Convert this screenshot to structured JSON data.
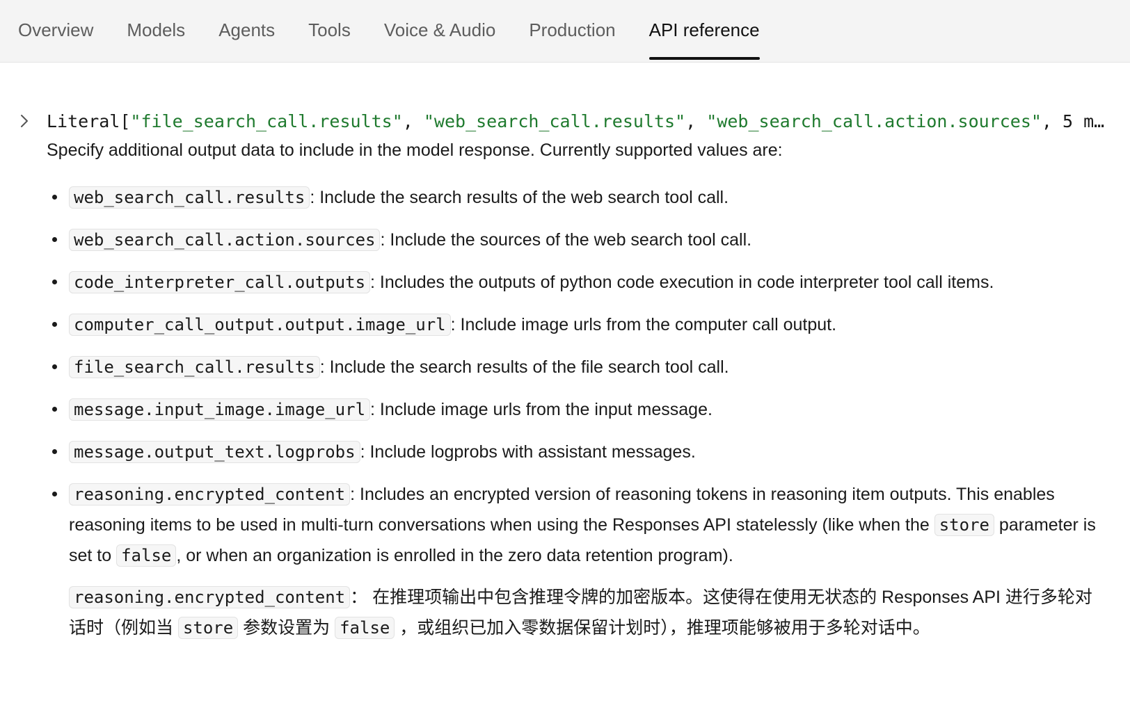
{
  "nav": {
    "tabs": [
      {
        "label": "Overview"
      },
      {
        "label": "Models"
      },
      {
        "label": "Agents"
      },
      {
        "label": "Tools"
      },
      {
        "label": "Voice & Audio"
      },
      {
        "label": "Production"
      },
      {
        "label": "API reference"
      }
    ],
    "active_tab": "API reference"
  },
  "param": {
    "type_prefix": "Literal[",
    "type_values": [
      "\"file_search_call.results\"",
      "\"web_search_call.results\"",
      "\"web_search_call.action.sources\""
    ],
    "separator": ", ",
    "type_more": "5 m…",
    "description": "Specify additional output data to include in the model response. Currently supported values are:",
    "options": [
      {
        "code": "web_search_call.results",
        "text": ": Include the search results of the web search tool call."
      },
      {
        "code": "web_search_call.action.sources",
        "text": ": Include the sources of the web search tool call."
      },
      {
        "code": "code_interpreter_call.outputs",
        "text": ": Includes the outputs of python code execution in code interpreter tool call items."
      },
      {
        "code": "computer_call_output.output.image_url",
        "text": ": Include image urls from the computer call output."
      },
      {
        "code": "file_search_call.results",
        "text": ": Include the search results of the file search tool call."
      },
      {
        "code": "message.input_image.image_url",
        "text": ": Include image urls from the input message."
      },
      {
        "code": "message.output_text.logprobs",
        "text": ": Include logprobs with assistant messages."
      }
    ],
    "reasoning": {
      "code": "reasoning.encrypted_content",
      "text_1": ": Includes an encrypted version of reasoning tokens in reasoning item outputs. This enables reasoning items to be used in multi-turn conversations when using the Responses API statelessly (like when the ",
      "code_store": "store",
      "text_2": " parameter is set to ",
      "code_false": "false",
      "text_3": ", or when an organization is enrolled in the zero data retention program).",
      "zh_code": "reasoning.encrypted_content",
      "zh_text_1": "： 在推理项输出中包含推理令牌的加密版本。这使得在使用无状态的 Responses API 进行多轮对话时（例如当 ",
      "zh_code_store": "store",
      "zh_text_2": " 参数设置为 ",
      "zh_code_false": "false",
      "zh_text_3": " ，或组织已加入零数据保留计划时），推理项能够被用于多轮对话中。"
    }
  }
}
